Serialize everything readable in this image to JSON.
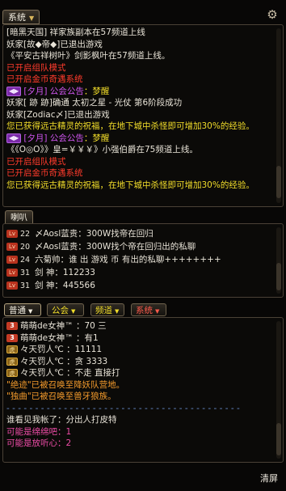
{
  "top_tab": {
    "label": "系统"
  },
  "system_lines": [
    {
      "text": "[暗黑天国] 祥家族副本在57频道上线",
      "color": "white"
    },
    {
      "text": "妖家[故◆帝◆]已退出游戏",
      "color": "white"
    },
    {
      "text": "《平安古祥树叶》剑影枫叶在57频道上线。",
      "color": "white"
    },
    {
      "text": "已开启组队模式",
      "color": "red"
    },
    {
      "text": "已开启金币奇遇系统",
      "color": "red"
    },
    {
      "badge": "[夕月] 公会公告",
      "text": "：梦醒",
      "color": "yellow"
    },
    {
      "text": "妖家[ 跡 跡]确通 太初之星 - 光仗 第6阶段成功",
      "color": "white"
    },
    {
      "text": "妖家[Zodiac〆]已退出游戏",
      "color": "white"
    },
    {
      "text": "您已获得远古精灵的祝福，在地下城中杀怪即可增加30%的经验。",
      "color": "yellow"
    },
    {
      "badge": "[夕月] 公会公告",
      "text": "：梦醒",
      "color": "yellow"
    },
    {
      "text": "《《O◎O》》皇=￥￥￥》小强伯爵在75频道上线。",
      "color": "white"
    },
    {
      "text": "已开启组队模式",
      "color": "red"
    },
    {
      "text": "已开启金币奇遇系统",
      "color": "red"
    },
    {
      "text": "您已获得远古精灵的祝福，在地下城中杀怪即可增加30%的经验。",
      "color": "yellow"
    }
  ],
  "mid_tab": {
    "label": "喇叭"
  },
  "horn_lines": [
    {
      "level": "22",
      "text": "〆Aosl蓝贵：300W找帝在回归",
      "color": "white"
    },
    {
      "level": "20",
      "text": "〆Aosl蓝贵：300W找个帝在回归出的私聊",
      "color": "white"
    },
    {
      "level": "24",
      "text": "六菊帅：谁 出    游戏  币                              有出的私聊++++++++",
      "color": "white"
    },
    {
      "level": "31",
      "text": "剑  神：112233",
      "color": "white"
    },
    {
      "level": "31",
      "text": "剑  神：445566",
      "color": "white"
    }
  ],
  "bottom_tabs": [
    {
      "label": "普通",
      "color": "#f4efe2"
    },
    {
      "label": "公会",
      "color": "#f2dd2a"
    },
    {
      "label": "频道",
      "color": "#f2dd2a"
    },
    {
      "label": "系统",
      "color": "#ff5b4c"
    }
  ],
  "chat_lines": [
    {
      "icon": "three",
      "text": "萌萌de女神™ ：70 三",
      "color": "white"
    },
    {
      "icon": "three",
      "text": "萌萌de女神™ ：有1",
      "color": "white"
    },
    {
      "icon": "tiger",
      "text": "々天罚人℃ ：11111",
      "color": "white"
    },
    {
      "icon": "tiger",
      "text": "々天罚人℃ ：贪    3333",
      "color": "white"
    },
    {
      "icon": "tiger",
      "text": "々天罚人℃ ：不走 直接打",
      "color": "white"
    },
    {
      "text": "\"绝迹\"已被召唤至降妖队营地。",
      "color": "orange"
    },
    {
      "text": "\"独曲\"已被召唤至兽牙狼族。",
      "color": "orange"
    }
  ],
  "divider": "- - - - - - - - - - - - - - - - - - - - - - - - - - - - - - - - - - - - - - - - -",
  "chat_lines_2": [
    {
      "text": "谁看见我帐了：分出人打皮特",
      "color": "white"
    },
    {
      "text": "可能是绵绵吧：1",
      "color": "pink"
    },
    {
      "text": "可能是放听心：2",
      "color": "pink"
    }
  ],
  "clear_label": "清屏",
  "colors": {
    "white": "#e8e3d7",
    "red": "#ff3b2c",
    "yellow": "#f2dd2a",
    "orange": "#f49b2c",
    "pink": "#ec4ca6",
    "border": "#4a4136"
  }
}
